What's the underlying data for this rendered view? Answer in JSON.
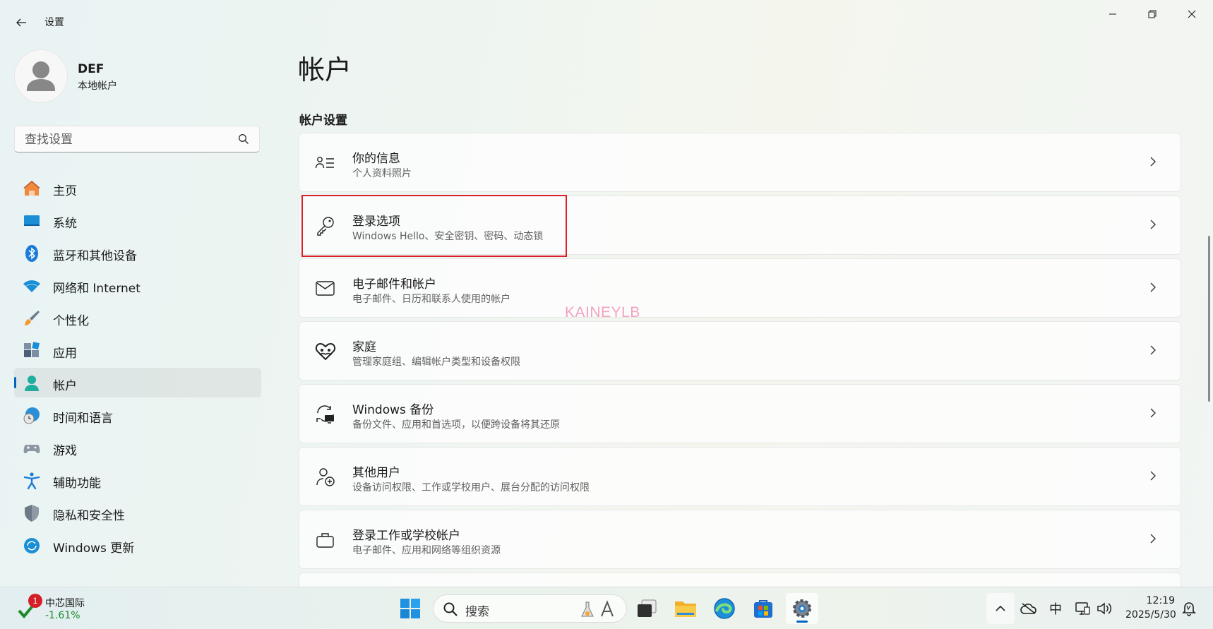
{
  "window": {
    "title": "设置"
  },
  "user": {
    "name": "DEF",
    "account_type": "本地帐户"
  },
  "search": {
    "placeholder": "查找设置"
  },
  "sidebar": {
    "items": [
      {
        "label": "主页",
        "icon": "home-icon"
      },
      {
        "label": "系统",
        "icon": "system-icon"
      },
      {
        "label": "蓝牙和其他设备",
        "icon": "bluetooth-icon"
      },
      {
        "label": "网络和 Internet",
        "icon": "wifi-icon"
      },
      {
        "label": "个性化",
        "icon": "brush-icon"
      },
      {
        "label": "应用",
        "icon": "apps-icon"
      },
      {
        "label": "帐户",
        "icon": "account-icon",
        "selected": true
      },
      {
        "label": "时间和语言",
        "icon": "time-language-icon"
      },
      {
        "label": "游戏",
        "icon": "gamepad-icon"
      },
      {
        "label": "辅助功能",
        "icon": "accessibility-icon"
      },
      {
        "label": "隐私和安全性",
        "icon": "shield-icon"
      },
      {
        "label": "Windows 更新",
        "icon": "windows-update-icon"
      }
    ]
  },
  "main": {
    "page_title": "帐户",
    "section_title": "帐户设置",
    "cards": [
      {
        "title": "你的信息",
        "subtitle": "个人资料照片",
        "icon": "person-info-icon"
      },
      {
        "title": "登录选项",
        "subtitle": "Windows Hello、安全密钥、密码、动态锁",
        "icon": "key-icon",
        "highlighted": true
      },
      {
        "title": "电子邮件和帐户",
        "subtitle": "电子邮件、日历和联系人使用的帐户",
        "icon": "mail-icon"
      },
      {
        "title": "家庭",
        "subtitle": "管理家庭组、编辑帐户类型和设备权限",
        "icon": "family-heart-icon"
      },
      {
        "title": "Windows 备份",
        "subtitle": "备份文件、应用和首选项，以便跨设备将其还原",
        "icon": "backup-icon"
      },
      {
        "title": "其他用户",
        "subtitle": "设备访问权限、工作或学校用户、展台分配的访问权限",
        "icon": "add-user-icon"
      },
      {
        "title": "登录工作或学校帐户",
        "subtitle": "电子邮件、应用和网络等组织资源",
        "icon": "briefcase-icon"
      }
    ],
    "watermark": "KAINEYLB"
  },
  "taskbar": {
    "stock": {
      "badge": "1",
      "name": "中芯国际",
      "change": "-1.61%"
    },
    "search_label": "搜索",
    "ime": "中",
    "time": "12:19",
    "date": "2025/5/30"
  },
  "colors": {
    "accent": "#0067c0",
    "highlight_box": "#d9212b",
    "stock_negative": "#1c8a2a",
    "badge": "#d61e28"
  }
}
